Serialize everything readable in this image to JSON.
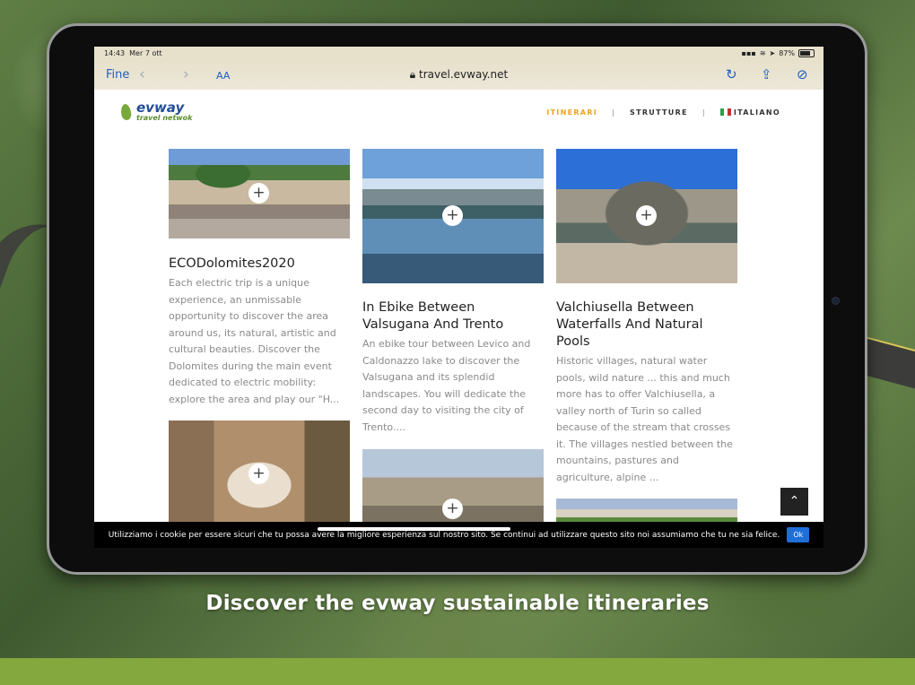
{
  "caption": "Discover the evway sustainable itineraries",
  "status": {
    "time": "14:43",
    "date": "Mer 7 ott",
    "battery": "87%"
  },
  "browser": {
    "done_label": "Fine",
    "text_size_label": "AA",
    "url": "travel.evway.net",
    "back_icon": "chevron-left-icon",
    "forward_icon": "chevron-right-icon",
    "reload_icon": "reload-icon",
    "share_icon": "share-icon",
    "compass_icon": "compass-icon"
  },
  "site": {
    "logo_main": "evway",
    "logo_sub": "travel netwok",
    "menu": {
      "itinerari": "ITINERARI",
      "strutture": "STRUTTURE",
      "italiano": "ITALIANO"
    },
    "accent_color": "#f0a41b"
  },
  "cards": [
    {
      "title": "ECODolomites2020",
      "description": "Each electric trip is a unique experience, an unmissable opportunity to discover the area around us, its natural, artistic and cultural beauties. Discover the Dolomites during the main event dedicated to electric mobility: explore the area and play our \"H..."
    },
    {
      "title": "In Ebike Between Valsugana And Trento",
      "description": "An ebike tour between Levico and Caldonazzo lake to discover the Valsugana and its splendid landscapes. You will dedicate the second day to visiting the city of Trento...."
    },
    {
      "title": "Valchiusella Between Waterfalls And Natural Pools",
      "description": "Historic villages, natural water pools, wild nature ... this and much more has to offer Valchiusella, a valley north of Turin so called because of the stream that crosses it. The villages nestled between the mountains, pastures and agriculture, alpine ..."
    }
  ],
  "plus_symbol": "+",
  "back_to_top_symbol": "⌃",
  "cookie": {
    "text": "Utilizziamo i cookie per essere sicuri che tu possa avere la migliore esperienza sul nostro sito. Se continui ad utilizzare questo sito noi assumiamo che tu ne sia felice.",
    "ok_label": "Ok"
  }
}
